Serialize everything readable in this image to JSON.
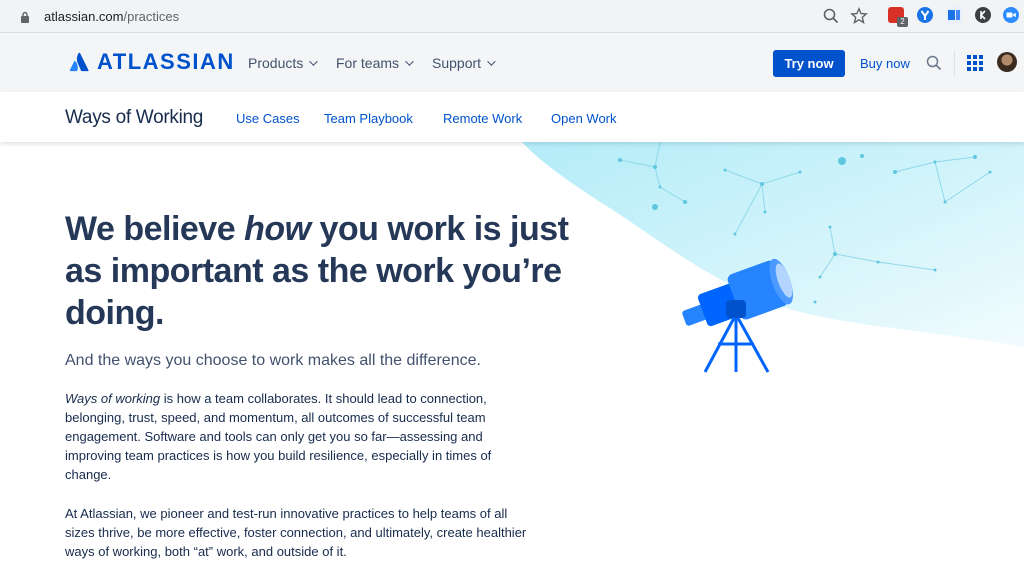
{
  "browser": {
    "url_domain": "atlassian.com",
    "url_path": "/practices",
    "ext_badge": "2"
  },
  "header": {
    "logo_text": "ATLASSIAN",
    "nav": [
      "Products",
      "For teams",
      "Support"
    ],
    "try_label": "Try now",
    "buy_label": "Buy now"
  },
  "subnav": {
    "title": "Ways of Working",
    "links": [
      "Use Cases",
      "Team Playbook",
      "Remote Work",
      "Open Work"
    ]
  },
  "hero": {
    "heading_before": "We believe ",
    "heading_em": "how",
    "heading_after": " you work is just as important as the work you’re doing.",
    "subheading": "And the ways you choose to work makes all the difference.",
    "p1_em": "Ways of working",
    "p1_rest": " is how a team collaborates. It should lead to connection, belonging, trust, speed, and momentum, all outcomes of successful team engagement. Software and tools can only get you so far—assessing and improving team practices is how you build resilience, especially in times of change.",
    "p2": "At Atlassian, we pioneer and test-run innovative practices to help teams of all sizes thrive, be more effective, foster connection, and ultimately, create healthier ways of working, both “at” work, and outside of it."
  },
  "colors": {
    "brand_blue": "#0052cc",
    "heading_navy": "#253858",
    "sky_cyan": "#c7f0fa"
  }
}
